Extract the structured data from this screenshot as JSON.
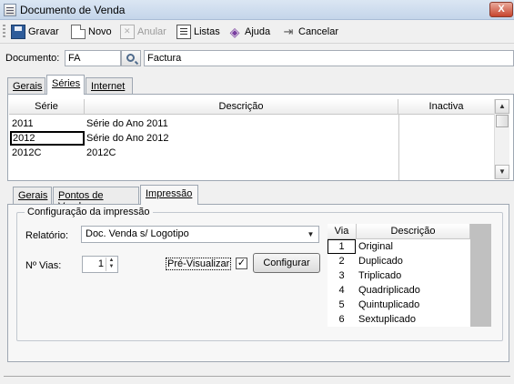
{
  "window": {
    "title": "Documento de Venda",
    "close_label": "X"
  },
  "toolbar": {
    "save": "Gravar",
    "new": "Novo",
    "annul": "Anular",
    "lists": "Listas",
    "help": "Ajuda",
    "cancel": "Cancelar"
  },
  "document": {
    "label": "Documento:",
    "code": "FA",
    "name": "Factura"
  },
  "top_tabs": {
    "general": "Gerais",
    "series": "Séries",
    "internet": "Internet"
  },
  "series_grid": {
    "headers": {
      "serie": "Série",
      "descricao": "Descrição",
      "inactiva": "Inactiva"
    },
    "rows": [
      {
        "serie": "2011",
        "descricao": "Série do Ano 2011"
      },
      {
        "serie": "2012",
        "descricao": "Série do Ano 2012"
      },
      {
        "serie": "2012C",
        "descricao": "2012C"
      }
    ]
  },
  "sub_tabs": {
    "general": "Gerais",
    "points_of_sale": "Pontos de Venda",
    "printing": "Impressão"
  },
  "printing": {
    "group_title": "Configuração da impressão",
    "report_label": "Relatório:",
    "report_value": "Doc. Venda s/ Logotipo",
    "copies_label": "Nº Vias:",
    "copies_value": "1",
    "preview_label": "Pré-Visualizar",
    "preview_checked": "✓",
    "configure_button": "Configurar",
    "copies_grid": {
      "headers": {
        "via": "Via",
        "descricao": "Descrição"
      },
      "rows": [
        {
          "via": "1",
          "descricao": "Original"
        },
        {
          "via": "2",
          "descricao": "Duplicado"
        },
        {
          "via": "3",
          "descricao": "Triplicado"
        },
        {
          "via": "4",
          "descricao": "Quadriplicado"
        },
        {
          "via": "5",
          "descricao": "Quintuplicado"
        },
        {
          "via": "6",
          "descricao": "Sextuplicado"
        }
      ]
    }
  }
}
